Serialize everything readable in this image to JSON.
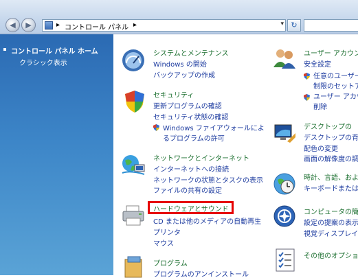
{
  "address_bar": {
    "path_sep1": "▸",
    "path": "コントロール パネル",
    "path_sep2": "▸",
    "dropdown": "▾",
    "refresh_icon": "↻"
  },
  "nav": {
    "back": "◀",
    "forward": "▶"
  },
  "sidebar": {
    "home_label": "コントロール パネル ホーム",
    "classic_label": "クラシック表示"
  },
  "categories": {
    "system": {
      "title": "システムとメンテナンス",
      "links": [
        "Windows の開始",
        "バックアップの作成"
      ]
    },
    "security": {
      "title": "セキュリティ",
      "links": [
        "更新プログラムの確認",
        "セキュリティ状態の確認",
        "Windows ファイアウォールによ",
        "るプログラムの許可"
      ]
    },
    "network": {
      "title": "ネットワークとインターネット",
      "links": [
        "インターネットへの接続",
        "ネットワークの状態とタスクの表示",
        "ファイルの共有の設定"
      ]
    },
    "hardware": {
      "title": "ハードウェアとサウンド",
      "links": [
        "CD または他のメディアの自動再生",
        "プリンタ",
        "マウス"
      ]
    },
    "programs": {
      "title": "プログラム",
      "links": [
        "プログラムのアンインストール"
      ]
    },
    "user": {
      "title": "ユーザー アカウン",
      "links": [
        "安全設定",
        "任意のユーザー",
        "制限のセットア",
        "ユーザー アカウ",
        "削除"
      ]
    },
    "desktop": {
      "title": "デスクトップの",
      "links": [
        "デスクトップの背",
        "配色の変更",
        "画面の解像度の調"
      ]
    },
    "clock": {
      "title": "時計、言語、およ",
      "links": [
        "キーボードまたは"
      ]
    },
    "ease": {
      "title": "コンピュータの簡",
      "links": [
        "設定の提案の表示",
        "視覚ディスプレイ"
      ]
    },
    "other": {
      "title": "その他のオプショ",
      "links": []
    }
  },
  "colors": {
    "highlight": "#e60000",
    "category_title": "#1a6e2e",
    "link": "#1f3da0"
  }
}
